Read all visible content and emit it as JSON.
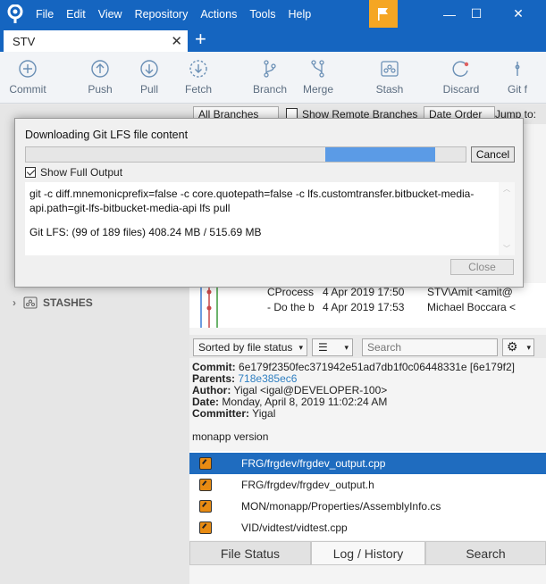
{
  "titlebar": {
    "menu": [
      "File",
      "Edit",
      "View",
      "Repository",
      "Actions",
      "Tools",
      "Help"
    ],
    "minimize": "—",
    "maximize": "☐",
    "close": "✕"
  },
  "tab": {
    "label": "STV",
    "close": "✕",
    "add": "+"
  },
  "toolbar": {
    "commit": "Commit",
    "push": "Push",
    "pull": "Pull",
    "fetch": "Fetch",
    "branch": "Branch",
    "merge": "Merge",
    "stash": "Stash",
    "discard": "Discard",
    "gitflow": "Git f"
  },
  "sidebar": {
    "stashes": "STASHES"
  },
  "filters": {
    "branches": "All Branches",
    "show_remote": "Show Remote Branches",
    "date_order": "Date Order",
    "jump_to": "Jump to:"
  },
  "commits": [
    {
      "desc": "CProcess",
      "date": "4 Apr 2019 17:50",
      "author": "STV\\Amit <amit@"
    },
    {
      "desc": "- Do the b",
      "date": "4 Apr 2019 17:53",
      "author": "Michael Boccara <"
    }
  ],
  "filebar": {
    "sort": "Sorted by file status",
    "search_placeholder": "Search"
  },
  "details": {
    "commit_label": "Commit:",
    "commit_value": "6e179f2350fec371942e51ad7db1f0c06448331e [6e179f2]",
    "parents_label": "Parents:",
    "parents_value": "718e385ec6",
    "author_label": "Author:",
    "author_value": "Yigal <igal@DEVELOPER-100>",
    "date_label": "Date:",
    "date_value": "Monday, April 8, 2019 11:02:24 AM",
    "committer_label": "Committer:",
    "committer_value": "Yigal",
    "message": "monapp version"
  },
  "files": [
    "FRG/frgdev/frgdev_output.cpp",
    "FRG/frgdev/frgdev_output.h",
    "MON/monapp/Properties/AssemblyInfo.cs",
    "VID/vidtest/vidtest.cpp"
  ],
  "bottom_tabs": [
    "File Status",
    "Log / History",
    "Search"
  ],
  "dialog": {
    "title": "Downloading Git LFS file content",
    "progress": {
      "start": 0.68,
      "end": 0.93
    },
    "cancel": "Cancel",
    "show_full_output": "Show Full Output",
    "command": "git -c diff.mnemonicprefix=false -c core.quotepath=false -c lfs.customtransfer.bitbucket-media-api.path=git-lfs-bitbucket-media-api lfs pull",
    "status": "Git LFS: (99 of 189 files) 408.24 MB / 515.69 MB",
    "close": "Close"
  },
  "colors": {
    "titlebar": "#1565c0",
    "flag": "#f5a623",
    "progress": "#5b9be6",
    "selection": "#1f6cbf",
    "link": "#2f7fc1"
  }
}
